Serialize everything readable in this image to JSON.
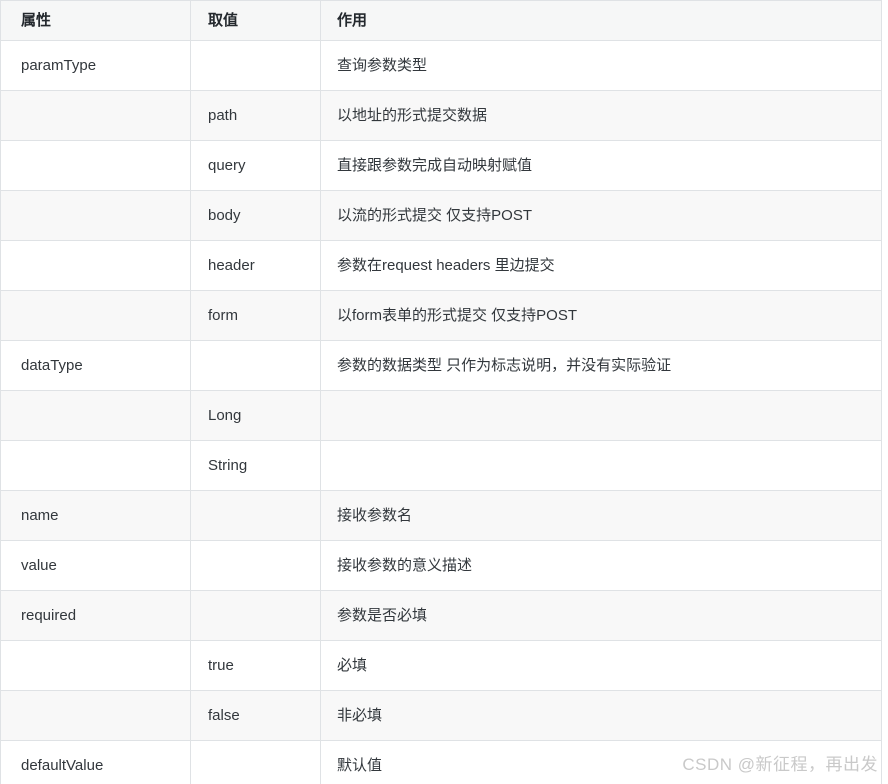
{
  "table": {
    "columns": [
      {
        "key": "attribute",
        "label": "属性"
      },
      {
        "key": "value",
        "label": "取值"
      },
      {
        "key": "role",
        "label": "作用"
      }
    ],
    "rows": [
      {
        "attribute": "paramType",
        "value": "",
        "role": "查询参数类型"
      },
      {
        "attribute": "",
        "value": "path",
        "role": "以地址的形式提交数据"
      },
      {
        "attribute": "",
        "value": "query",
        "role": "直接跟参数完成自动映射赋值"
      },
      {
        "attribute": "",
        "value": "body",
        "role": "以流的形式提交 仅支持POST"
      },
      {
        "attribute": "",
        "value": "header",
        "role": "参数在request headers 里边提交"
      },
      {
        "attribute": "",
        "value": "form",
        "role": "以form表单的形式提交 仅支持POST"
      },
      {
        "attribute": "dataType",
        "value": "",
        "role": "参数的数据类型 只作为标志说明，并没有实际验证"
      },
      {
        "attribute": "",
        "value": "Long",
        "role": ""
      },
      {
        "attribute": "",
        "value": "String",
        "role": ""
      },
      {
        "attribute": "name",
        "value": "",
        "role": "接收参数名"
      },
      {
        "attribute": "value",
        "value": "",
        "role": "接收参数的意义描述"
      },
      {
        "attribute": "required",
        "value": "",
        "role": "参数是否必填"
      },
      {
        "attribute": "",
        "value": "true",
        "role": "必填"
      },
      {
        "attribute": "",
        "value": "false",
        "role": "非必填"
      },
      {
        "attribute": "defaultValue",
        "value": "",
        "role": "默认值"
      }
    ]
  },
  "watermark": {
    "text": "CSDN @新征程，再出发"
  },
  "colors": {
    "border": "#dfe2e5",
    "header_bg": "#f6f7f7",
    "row_alt_bg": "#f8f8f8",
    "text": "#32373c",
    "watermark": "#c9c9c9"
  }
}
